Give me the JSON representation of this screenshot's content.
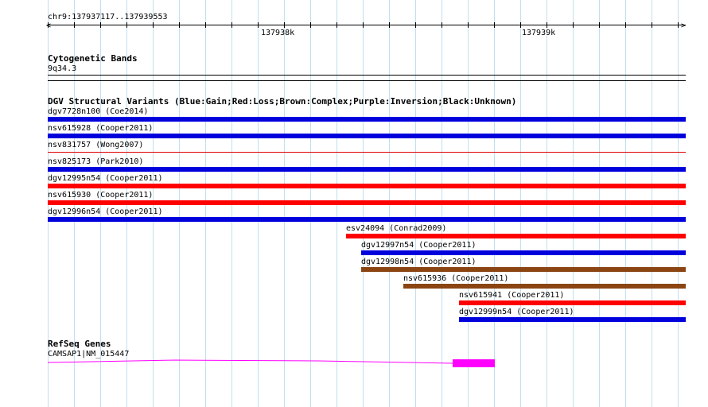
{
  "ruler": {
    "region": "chr9:137937117..137939553",
    "ticks": [
      "137938k",
      "137939k"
    ]
  },
  "cytoband": {
    "title": "Cytogenetic Bands",
    "band": "9q34.3"
  },
  "dgv": {
    "title": "DGV Structural Variants (Blue:Gain;Red:Loss;Brown:Complex;Purple:Inversion;Black:Unknown)",
    "colors": {
      "gain": "#0000dd",
      "loss": "#ff0000",
      "complex": "#8b4513",
      "thin_loss": "#dd0000"
    },
    "variants": [
      {
        "label": "dgv7728n100 (Coe2014)",
        "type": "gain"
      },
      {
        "label": "nsv615928 (Cooper2011)",
        "type": "gain"
      },
      {
        "label": "nsv831757 (Wong2007)",
        "type": "thin_loss"
      },
      {
        "label": "nsv825173 (Park2010)",
        "type": "gain"
      },
      {
        "label": "dgv12995n54 (Cooper2011)",
        "type": "loss"
      },
      {
        "label": "nsv615930 (Cooper2011)",
        "type": "loss"
      },
      {
        "label": "dgv12996n54 (Cooper2011)",
        "type": "gain"
      },
      {
        "label": "esv24094 (Conrad2009)",
        "type": "loss"
      },
      {
        "label": "dgv12997n54 (Cooper2011)",
        "type": "gain"
      },
      {
        "label": "dgv12998n54 (Cooper2011)",
        "type": "complex"
      },
      {
        "label": "nsv615936 (Cooper2011)",
        "type": "complex"
      },
      {
        "label": "nsv615941 (Cooper2011)",
        "type": "loss"
      },
      {
        "label": "dgv12999n54 (Cooper2011)",
        "type": "gain"
      }
    ]
  },
  "refseq": {
    "title": "RefSeq Genes",
    "gene": "CAMSAP1|NM_015447",
    "color": "#ff00ff"
  }
}
